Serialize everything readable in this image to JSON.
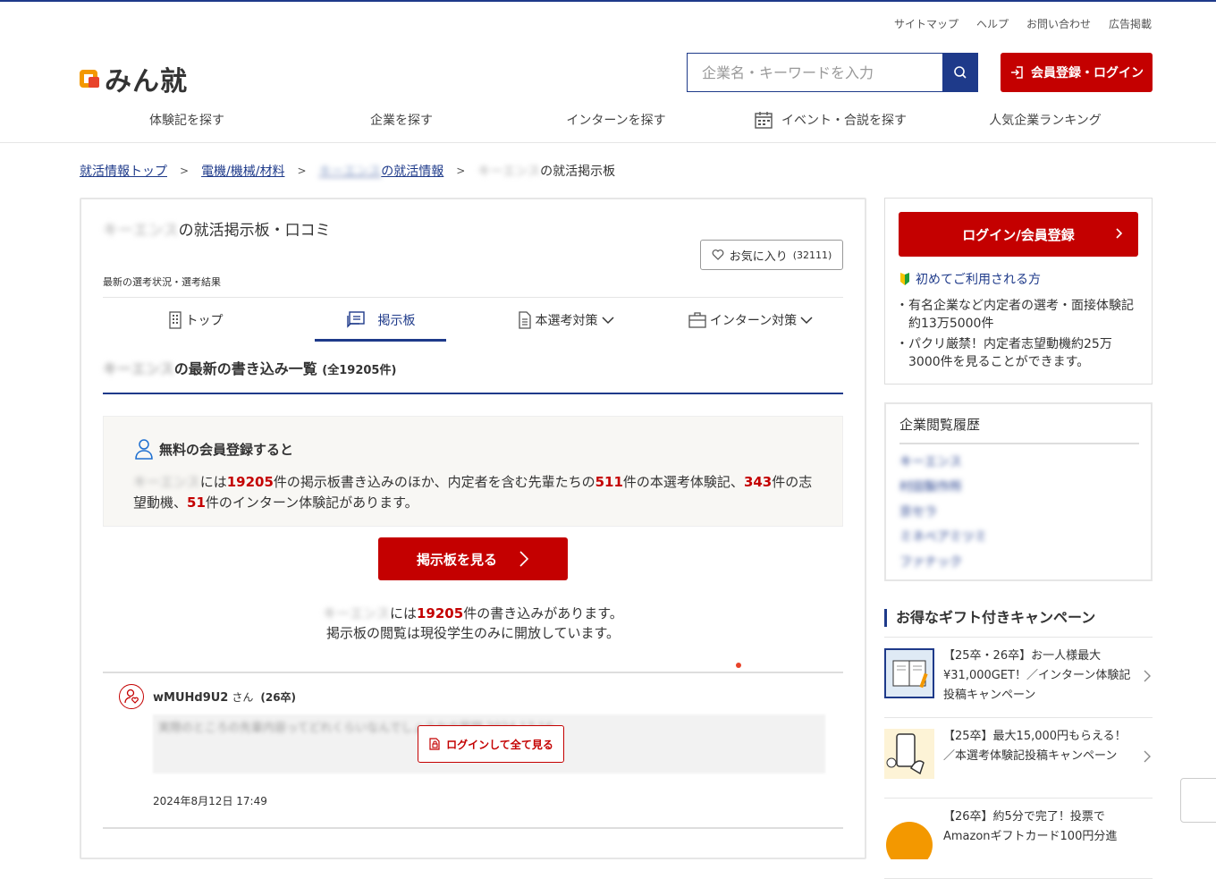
{
  "utility": [
    "サイトマップ",
    "ヘルプ",
    "お問い合わせ",
    "広告掲載"
  ],
  "logo": "みん就",
  "search": {
    "placeholder": "企業名・キーワードを入力"
  },
  "signup_label": "会員登録・ログイン",
  "gnav": [
    "体験記を探す",
    "企業を探す",
    "インターンを探す",
    "イベント・合説を探す",
    "人気企業ランキング"
  ],
  "breadcrumb": {
    "top": "就活情報トップ",
    "category": "電機/機械/材料",
    "company_mask": "キーエンス",
    "company_suffix": "の就活情報",
    "current_suffix": "の就活掲示板"
  },
  "main": {
    "company_mask": "キーエンス",
    "title_suffix": "の就活掲示板・口コミ",
    "favorite_label": "お気に入り",
    "favorite_count": "(32111)",
    "subtitle": "最新の選考状況・選考結果",
    "tabs": [
      "トップ",
      "掲示板",
      "本選考対策",
      "インターン対策"
    ],
    "list_heading_suffix": "の最新の書き込み一覧",
    "list_count": "(全19205件)",
    "promo_heading": "無料の会員登録すると",
    "promo": {
      "t1": "には",
      "n1": "19205",
      "t2": "件の掲示板書き込みのほか、内定者を含む先輩たちの",
      "n2": "511",
      "t3": "件の本選考体験記、",
      "n3": "343",
      "t4": "件の志望動機、",
      "n4": "51",
      "t5": "件のインターン体験記があります。"
    },
    "board_button": "掲示板を見る",
    "notice": {
      "t1": "には",
      "n1": "19205",
      "t2": "件の書き込みがあります。",
      "line2": "掲示板の閲覧は現役学生のみに開放しています。"
    },
    "post": {
      "user": "wMUHd9U2",
      "san": "さん",
      "year": "(26卒)",
      "masked_text": "実際のところの先輩内容ってどれくらいなんでしょうかの質問 2024 17:16",
      "login_more": "ログインして全て見る",
      "date": "2024年8月12日 17:49"
    }
  },
  "side": {
    "login_button": "ログイン/会員登録",
    "first_time": "初めてご利用される方",
    "bullets": [
      "有名企業など内定者の選考・面接体験記約13万5000件",
      "パクリ厳禁！内定者志望動機約25万3000件を見ることができます。"
    ],
    "history_title": "企業閲覧履歴",
    "history": [
      "キーエンス",
      "村田製作所",
      "京セラ",
      "ミネベアミツミ",
      "ファナック"
    ],
    "campaign_title": "お得なギフト付きキャンペーン",
    "campaigns": [
      "【25卒・26卒】お一人様最大¥31,000GET！／インターン体験記投稿キャンペーン",
      "【25卒】最大15,000円もらえる！／本選考体験記投稿キャンペーン",
      "【26卒】約5分で完了！投票でAmazonギフトカード100円分進"
    ]
  }
}
